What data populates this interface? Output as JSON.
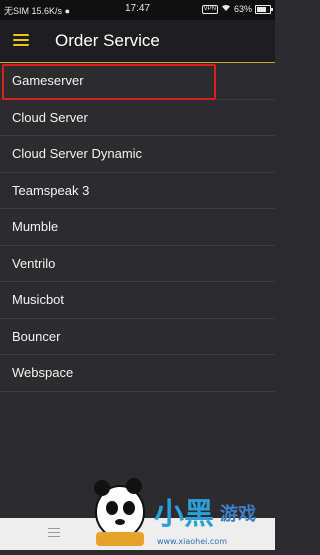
{
  "status_bar": {
    "carrier": "无SIM",
    "speed": "15.6K/s",
    "time": "17:47",
    "vpn": "VPN",
    "battery_percent": "63%",
    "battery_level": 0.63
  },
  "app_bar": {
    "menu_icon": "hamburger-menu-icon",
    "title": "Order Service",
    "accent_color": "#f0c419"
  },
  "services": [
    {
      "label": "Gameserver",
      "highlighted": true
    },
    {
      "label": "Cloud Server"
    },
    {
      "label": "Cloud Server Dynamic"
    },
    {
      "label": "Teamspeak 3"
    },
    {
      "label": "Mumble"
    },
    {
      "label": "Ventrilo"
    },
    {
      "label": "Musicbot"
    },
    {
      "label": "Bouncer"
    },
    {
      "label": "Webspace"
    }
  ],
  "watermark": {
    "logo_text": "小黑游戏",
    "url": "www.xiaohei.com"
  }
}
